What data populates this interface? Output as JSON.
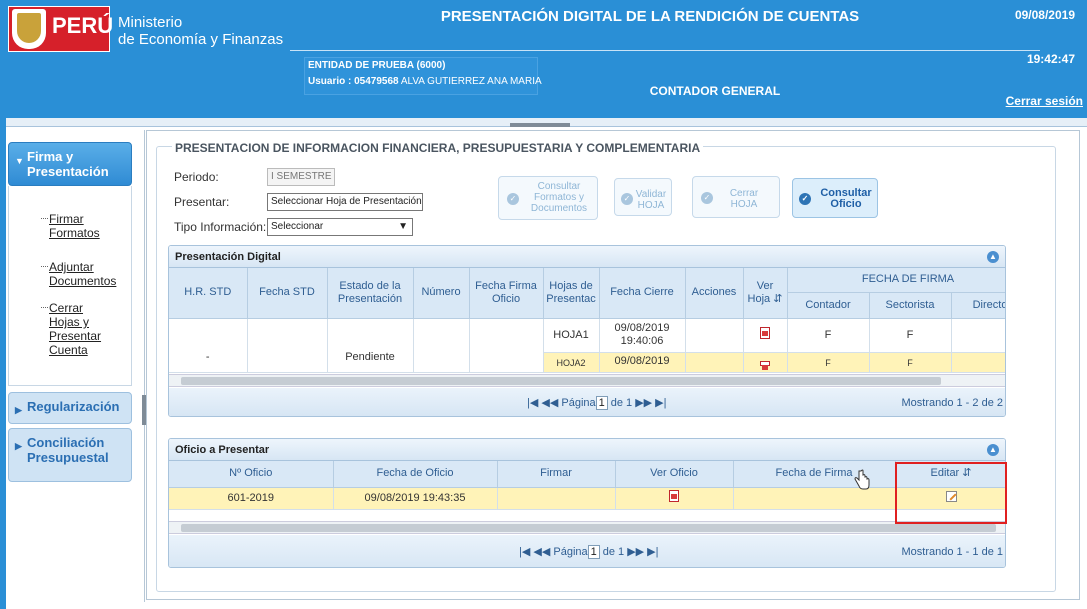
{
  "header": {
    "logo_text": "PERÚ",
    "ministry_line1": "Ministerio",
    "ministry_line2": "de Economía y Finanzas",
    "title": "PRESENTACIÓN DIGITAL DE LA RENDICIÓN DE CUENTAS",
    "date": "09/08/2019",
    "time": "19:42:47",
    "entity": "ENTIDAD DE PRUEBA (6000)",
    "user_label": "Usuario : 05479568",
    "user_name": "ALVA GUTIERREZ ANA MARIA",
    "role": "CONTADOR GENERAL",
    "logout": "Cerrar sesión"
  },
  "sidebar": {
    "items": [
      {
        "label": "Firma y Presentación"
      },
      {
        "label": "Regularización"
      },
      {
        "label": "Conciliación Presupuestal"
      }
    ],
    "sublinks": [
      "Firmar Formatos",
      "Adjuntar Documentos",
      "Cerrar Hojas y Presentar Cuenta"
    ]
  },
  "form": {
    "legend": "PRESENTACION DE INFORMACION FINANCIERA, PRESUPUESTARIA Y COMPLEMENTARIA",
    "periodo_label": "Periodo:",
    "periodo_value": "I SEMESTRE",
    "presentar_label": "Presentar:",
    "presentar_value": "Seleccionar Hoja de Presentación",
    "tipo_label": "Tipo Información:",
    "tipo_value": "Seleccionar",
    "buttons": {
      "consultar_formatos": "Consultar Formatos y Documentos",
      "validar": "Validar HOJA",
      "cerrar": "Cerrar HOJA",
      "consultar_oficio": "Consultar Oficio"
    }
  },
  "panel1": {
    "title": "Presentación Digital",
    "headers": [
      "H.R. STD",
      "Fecha STD",
      "Estado de la Presentación",
      "Número",
      "Fecha Firma Oficio",
      "Hojas de Presentac",
      "Fecha Cierre",
      "Acciones",
      "Ver Hoja",
      "FECHA DE FIRMA",
      "Contador",
      "Sectorista",
      "Directo"
    ],
    "rows": [
      {
        "hr": "-",
        "estado": "Pendiente",
        "hoja": "HOJA1",
        "fecha_cierre": "09/08/2019 19:40:06",
        "contador": "F",
        "sectorista": "F"
      },
      {
        "hoja": "HOJA2",
        "fecha_cierre": "09/08/2019",
        "contador": "F",
        "sectorista": "F"
      }
    ],
    "pager_label": "Página",
    "page": "1",
    "of": "de 1",
    "count": "Mostrando 1 - 2 de 2"
  },
  "panel2": {
    "title": "Oficio a Presentar",
    "headers": [
      "Nº Oficio",
      "Fecha de Oficio",
      "Firmar",
      "Ver Oficio",
      "Fecha de Firma",
      "Editar"
    ],
    "row": {
      "numero": "601-2019",
      "fecha": "09/08/2019 19:43:35"
    },
    "pager_label": "Página",
    "page": "1",
    "of": "de 1",
    "count": "Mostrando 1 - 1 de 1"
  },
  "colors": {
    "header_blue": "#2a8fd6",
    "highlight_row": "#fff3b8",
    "red_box": "#e02020"
  }
}
